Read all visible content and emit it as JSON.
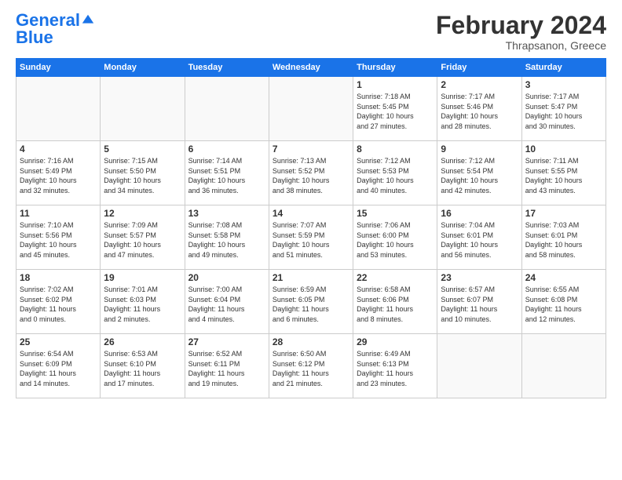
{
  "logo": {
    "line1": "General",
    "line2": "Blue"
  },
  "title": "February 2024",
  "location": "Thrapsanon, Greece",
  "headers": [
    "Sunday",
    "Monday",
    "Tuesday",
    "Wednesday",
    "Thursday",
    "Friday",
    "Saturday"
  ],
  "weeks": [
    [
      {
        "num": "",
        "info": ""
      },
      {
        "num": "",
        "info": ""
      },
      {
        "num": "",
        "info": ""
      },
      {
        "num": "",
        "info": ""
      },
      {
        "num": "1",
        "info": "Sunrise: 7:18 AM\nSunset: 5:45 PM\nDaylight: 10 hours\nand 27 minutes."
      },
      {
        "num": "2",
        "info": "Sunrise: 7:17 AM\nSunset: 5:46 PM\nDaylight: 10 hours\nand 28 minutes."
      },
      {
        "num": "3",
        "info": "Sunrise: 7:17 AM\nSunset: 5:47 PM\nDaylight: 10 hours\nand 30 minutes."
      }
    ],
    [
      {
        "num": "4",
        "info": "Sunrise: 7:16 AM\nSunset: 5:49 PM\nDaylight: 10 hours\nand 32 minutes."
      },
      {
        "num": "5",
        "info": "Sunrise: 7:15 AM\nSunset: 5:50 PM\nDaylight: 10 hours\nand 34 minutes."
      },
      {
        "num": "6",
        "info": "Sunrise: 7:14 AM\nSunset: 5:51 PM\nDaylight: 10 hours\nand 36 minutes."
      },
      {
        "num": "7",
        "info": "Sunrise: 7:13 AM\nSunset: 5:52 PM\nDaylight: 10 hours\nand 38 minutes."
      },
      {
        "num": "8",
        "info": "Sunrise: 7:12 AM\nSunset: 5:53 PM\nDaylight: 10 hours\nand 40 minutes."
      },
      {
        "num": "9",
        "info": "Sunrise: 7:12 AM\nSunset: 5:54 PM\nDaylight: 10 hours\nand 42 minutes."
      },
      {
        "num": "10",
        "info": "Sunrise: 7:11 AM\nSunset: 5:55 PM\nDaylight: 10 hours\nand 43 minutes."
      }
    ],
    [
      {
        "num": "11",
        "info": "Sunrise: 7:10 AM\nSunset: 5:56 PM\nDaylight: 10 hours\nand 45 minutes."
      },
      {
        "num": "12",
        "info": "Sunrise: 7:09 AM\nSunset: 5:57 PM\nDaylight: 10 hours\nand 47 minutes."
      },
      {
        "num": "13",
        "info": "Sunrise: 7:08 AM\nSunset: 5:58 PM\nDaylight: 10 hours\nand 49 minutes."
      },
      {
        "num": "14",
        "info": "Sunrise: 7:07 AM\nSunset: 5:59 PM\nDaylight: 10 hours\nand 51 minutes."
      },
      {
        "num": "15",
        "info": "Sunrise: 7:06 AM\nSunset: 6:00 PM\nDaylight: 10 hours\nand 53 minutes."
      },
      {
        "num": "16",
        "info": "Sunrise: 7:04 AM\nSunset: 6:01 PM\nDaylight: 10 hours\nand 56 minutes."
      },
      {
        "num": "17",
        "info": "Sunrise: 7:03 AM\nSunset: 6:01 PM\nDaylight: 10 hours\nand 58 minutes."
      }
    ],
    [
      {
        "num": "18",
        "info": "Sunrise: 7:02 AM\nSunset: 6:02 PM\nDaylight: 11 hours\nand 0 minutes."
      },
      {
        "num": "19",
        "info": "Sunrise: 7:01 AM\nSunset: 6:03 PM\nDaylight: 11 hours\nand 2 minutes."
      },
      {
        "num": "20",
        "info": "Sunrise: 7:00 AM\nSunset: 6:04 PM\nDaylight: 11 hours\nand 4 minutes."
      },
      {
        "num": "21",
        "info": "Sunrise: 6:59 AM\nSunset: 6:05 PM\nDaylight: 11 hours\nand 6 minutes."
      },
      {
        "num": "22",
        "info": "Sunrise: 6:58 AM\nSunset: 6:06 PM\nDaylight: 11 hours\nand 8 minutes."
      },
      {
        "num": "23",
        "info": "Sunrise: 6:57 AM\nSunset: 6:07 PM\nDaylight: 11 hours\nand 10 minutes."
      },
      {
        "num": "24",
        "info": "Sunrise: 6:55 AM\nSunset: 6:08 PM\nDaylight: 11 hours\nand 12 minutes."
      }
    ],
    [
      {
        "num": "25",
        "info": "Sunrise: 6:54 AM\nSunset: 6:09 PM\nDaylight: 11 hours\nand 14 minutes."
      },
      {
        "num": "26",
        "info": "Sunrise: 6:53 AM\nSunset: 6:10 PM\nDaylight: 11 hours\nand 17 minutes."
      },
      {
        "num": "27",
        "info": "Sunrise: 6:52 AM\nSunset: 6:11 PM\nDaylight: 11 hours\nand 19 minutes."
      },
      {
        "num": "28",
        "info": "Sunrise: 6:50 AM\nSunset: 6:12 PM\nDaylight: 11 hours\nand 21 minutes."
      },
      {
        "num": "29",
        "info": "Sunrise: 6:49 AM\nSunset: 6:13 PM\nDaylight: 11 hours\nand 23 minutes."
      },
      {
        "num": "",
        "info": ""
      },
      {
        "num": "",
        "info": ""
      }
    ]
  ]
}
